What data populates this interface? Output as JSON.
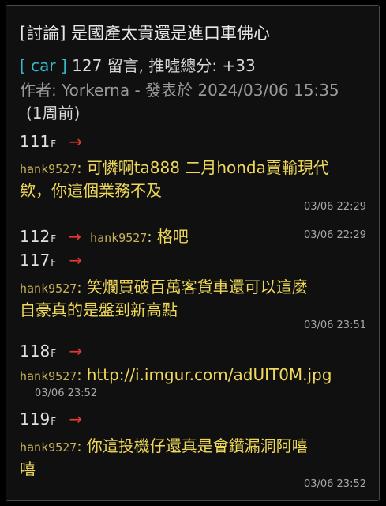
{
  "post": {
    "title": "[討論] 是國產太貴還是進口車佛心",
    "board": "[ car ]",
    "stats": "127 留言, 推噓總分: +33",
    "author_line": "作者: Yorkerna - 發表於 2024/03/06 15:35",
    "relative_time": "(1周前)"
  },
  "comments": [
    {
      "floor": "111",
      "floor_suffix": "F",
      "arrow": "→",
      "user": "hank9527",
      "line1": "可憐啊ta888 二月honda賣輸現代",
      "line2": "欸，你這個業務不及",
      "time": "03/06 22:29"
    },
    {
      "floor": "112",
      "floor_suffix": "F",
      "arrow": "→",
      "user": "hank9527",
      "line1": "格吧",
      "time": "03/06 22:29"
    },
    {
      "floor": "117",
      "floor_suffix": "F",
      "arrow": "→",
      "user": "hank9527",
      "line1": "笑爛買破百萬客貨車還可以這麼",
      "line2": "自豪真的是盤到新高點",
      "time": "03/06 23:51"
    },
    {
      "floor": "118",
      "floor_suffix": "F",
      "arrow": "→",
      "user": "hank9527",
      "line1": "http://i.imgur.com/adUIT0M.jpg",
      "time": "03/06 23:52"
    },
    {
      "floor": "119",
      "floor_suffix": "F",
      "arrow": "→",
      "user": "hank9527",
      "line1": "你這投機仔還真是會鑽漏洞阿嘻",
      "line2": "嘻",
      "time": "03/06 23:52"
    }
  ],
  "colors": {
    "arrow": "#e03a32",
    "user": "#c9b35a",
    "content": "#f0d95a",
    "board": "#36b8c8"
  }
}
